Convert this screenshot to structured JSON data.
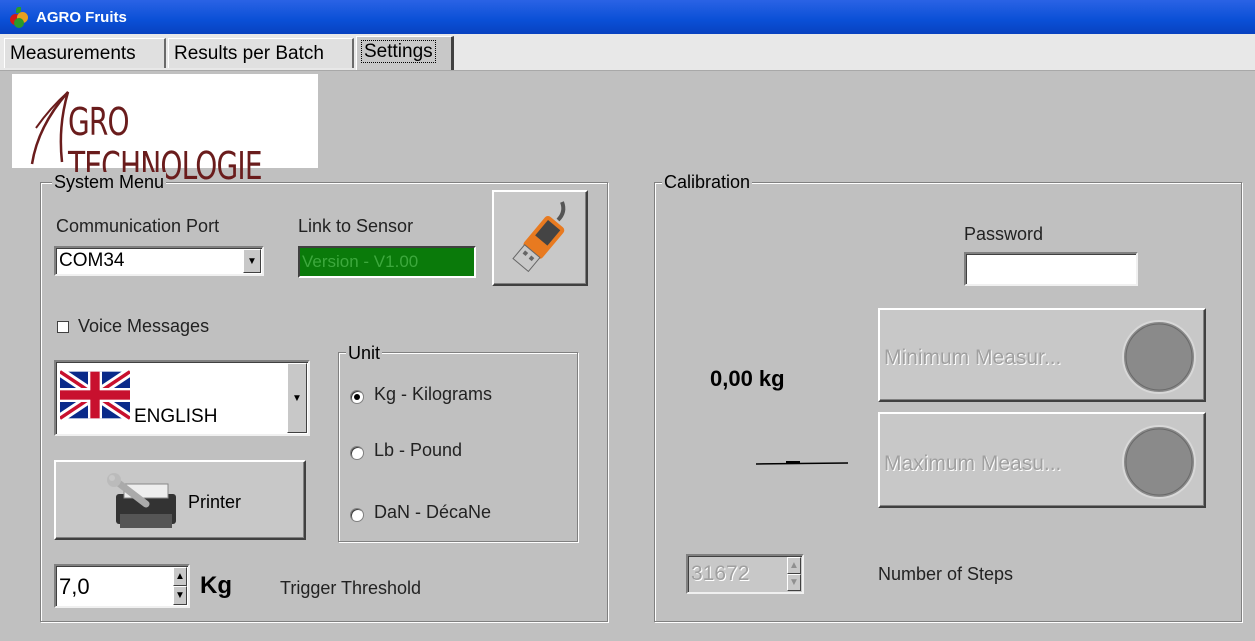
{
  "window": {
    "title": "AGRO Fruits"
  },
  "tabs": [
    {
      "label": "Measurements"
    },
    {
      "label": "Results per Batch"
    },
    {
      "label": "Settings"
    }
  ],
  "logo": {
    "text": "GRO TECHNOLOGIE"
  },
  "system_menu": {
    "title": "System Menu",
    "comm_port_label": "Communication Port",
    "comm_port_value": "COM34",
    "link_label": "Link to Sensor",
    "link_value": "Version - V1.00",
    "voice_label": "Voice Messages",
    "voice_checked": false,
    "language_value": "ENGLISH",
    "printer_label": "Printer",
    "threshold_value": "7,0",
    "threshold_unit": "Kg",
    "threshold_label": "Trigger Threshold",
    "unit": {
      "title": "Unit",
      "options": [
        {
          "label": "Kg  -  Kilograms",
          "selected": true
        },
        {
          "label": "Lb  -  Pound",
          "selected": false
        },
        {
          "label": "DaN - DécaNe",
          "selected": false
        }
      ]
    }
  },
  "calibration": {
    "title": "Calibration",
    "password_label": "Password",
    "password_value": "",
    "current_reading": "0,00 kg",
    "min_button_label": "Minimum Measur...",
    "max_button_label": "Maximum Measu...",
    "steps_value": "31672",
    "steps_label": "Number of Steps"
  },
  "colors": {
    "titlebar": "#0a4fd6",
    "link_status_bg": "#0a7a0a",
    "link_status_text": "#3da83d",
    "logo_text": "#6a1c1c"
  }
}
